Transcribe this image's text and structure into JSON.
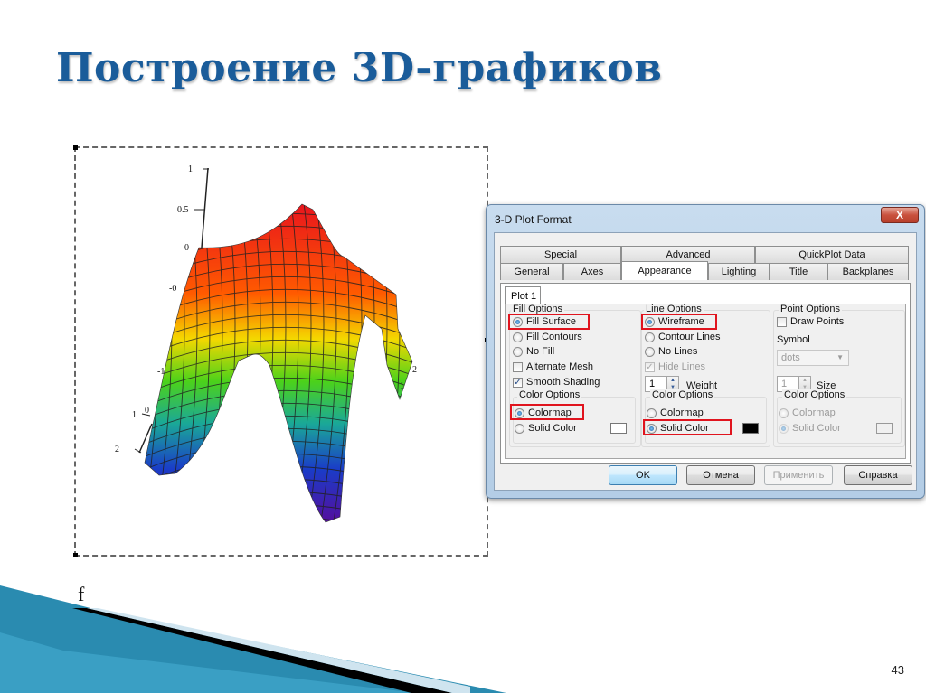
{
  "slide": {
    "title": "Построение 3D-графиков",
    "page_number": "43",
    "colors": {
      "title": "#1a5c9a",
      "accent_band": "#2a8bb0",
      "highlight_box": "#e0141e"
    }
  },
  "plot": {
    "function_label": "f",
    "z_axis_ticks": [
      "1",
      "0.5",
      "0",
      "-0",
      "-1",
      "0"
    ],
    "y_axis_ticks": [
      "1",
      "2"
    ],
    "x_axis_ticks": [
      "2",
      "1"
    ],
    "colormap": [
      "#e8141e",
      "#ff6a00",
      "#f4d800",
      "#4cd21a",
      "#1aa898",
      "#1a3cc8",
      "#5a0a9a"
    ]
  },
  "dialog": {
    "title": "3-D Plot Format",
    "close_label": "X",
    "tabs_row1": [
      "Special",
      "Advanced",
      "QuickPlot Data"
    ],
    "tabs_row2": [
      "General",
      "Axes",
      "Appearance",
      "Lighting",
      "Title",
      "Backplanes"
    ],
    "active_tab": "Appearance",
    "subtab": "Plot 1",
    "fill_options": {
      "label": "Fill Options",
      "items": [
        {
          "label": "Fill Surface",
          "type": "radio",
          "checked": true
        },
        {
          "label": "Fill Contours",
          "type": "radio",
          "checked": false
        },
        {
          "label": "No Fill",
          "type": "radio",
          "checked": false
        },
        {
          "label": "Alternate Mesh",
          "type": "checkbox",
          "checked": false
        },
        {
          "label": "Smooth Shading",
          "type": "checkbox",
          "checked": true
        }
      ],
      "color_options": {
        "label": "Color Options",
        "colormap": "Colormap",
        "solid_color": "Solid Color",
        "selected": "Colormap",
        "swatch": "#ffffff"
      }
    },
    "line_options": {
      "label": "Line Options",
      "items": [
        {
          "label": "Wireframe",
          "type": "radio",
          "checked": true
        },
        {
          "label": "Contour Lines",
          "type": "radio",
          "checked": false
        },
        {
          "label": "No Lines",
          "type": "radio",
          "checked": false
        },
        {
          "label": "Hide Lines",
          "type": "checkbox",
          "checked": true,
          "disabled": true
        }
      ],
      "weight_value": "1",
      "weight_label": "Weight",
      "color_options": {
        "label": "Color Options",
        "colormap": "Colormap",
        "solid_color": "Solid Color",
        "selected": "Solid Color",
        "swatch": "#000000"
      }
    },
    "point_options": {
      "label": "Point Options",
      "draw_points": "Draw Points",
      "draw_points_checked": false,
      "symbol_label": "Symbol",
      "symbol_value": "dots",
      "size_value": "1",
      "size_label": "Size",
      "color_options": {
        "label": "Color Options",
        "colormap": "Colormap",
        "solid_color": "Solid Color",
        "selected": "Solid Color",
        "swatch": "#f0f0f0"
      }
    },
    "buttons": {
      "ok": "OK",
      "cancel": "Отмена",
      "apply": "Применить",
      "help": "Справка"
    }
  }
}
